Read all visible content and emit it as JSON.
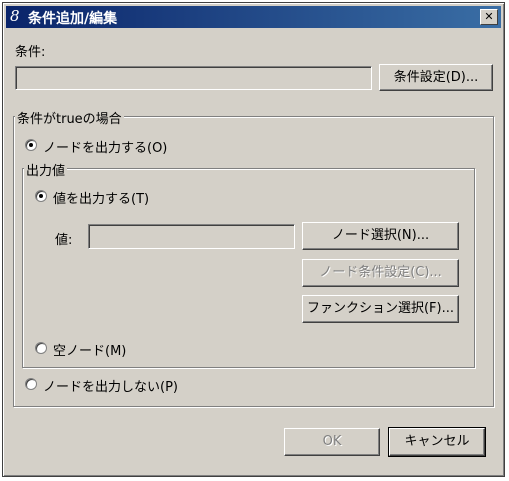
{
  "title": {
    "icon": "8",
    "text": "条件追加/編集"
  },
  "condition": {
    "label": "条件:",
    "value": "",
    "set_button": "条件設定(D)..."
  },
  "true_group": {
    "legend": "条件がtrueの場合",
    "radio_output_node": "ノードを出力する(O)",
    "output_group": {
      "legend": "出力値",
      "radio_output_value": "値を出力する(T)",
      "value_label": "値:",
      "value": "",
      "node_select_button": "ノード選択(N)...",
      "node_condition_button": "ノード条件設定(C)...",
      "function_select_button": "ファンクション選択(F)...",
      "radio_empty_node": "空ノード(M)"
    },
    "radio_no_output": "ノードを出力しない(P)"
  },
  "footer": {
    "ok": "OK",
    "cancel": "キャンセル"
  },
  "colors": {
    "titlebar_start": "#0a246a",
    "titlebar_end": "#3a6ea5",
    "dialog_bg": "#d4d0c8"
  },
  "state": {
    "output_node_selected": true,
    "output_value_selected": true,
    "empty_node_selected": false,
    "no_output_selected": false
  }
}
